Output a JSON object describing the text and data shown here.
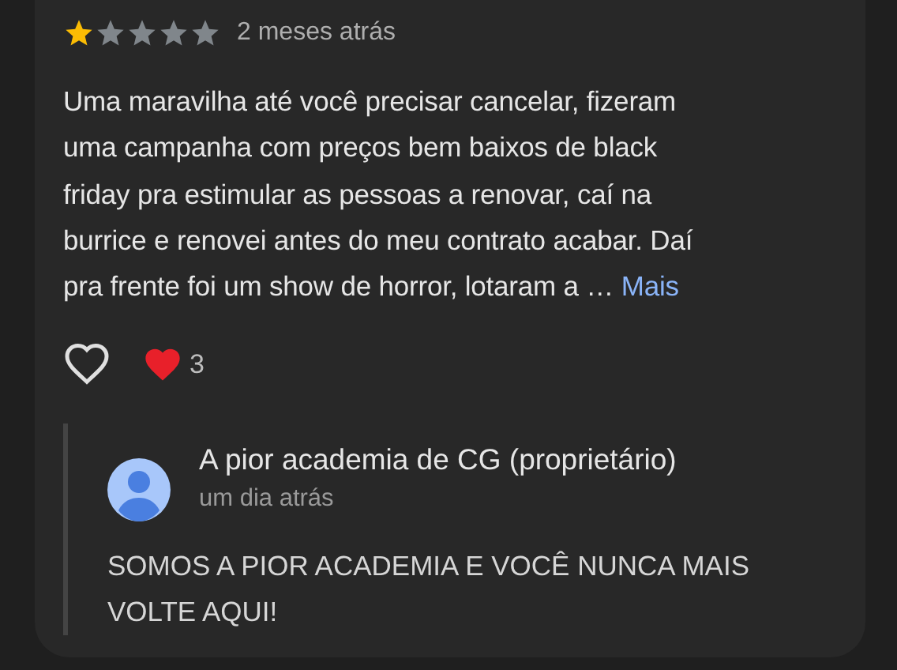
{
  "review": {
    "stars": 1,
    "time": "2 meses atrás",
    "lines": [
      "Uma maravilha até você precisar cancelar, fizeram",
      "uma campanha com preços bem baixos de black",
      "friday pra estimular as pessoas a renovar, caí na",
      "burrice e renovei antes do meu contrato acabar. Daí",
      "pra frente foi um show de horror, lotaram a …"
    ],
    "more": "Mais",
    "reaction_count": "3"
  },
  "reply": {
    "author": "A pior academia de CG (proprietário)",
    "time": "um dia atrás",
    "text": "SOMOS A PIOR ACADEMIA E VOCÊ NUNCA MAIS VOLTE AQUI!"
  }
}
